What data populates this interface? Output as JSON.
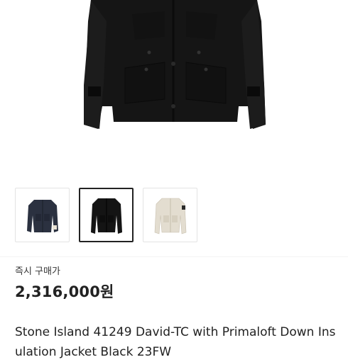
{
  "images": {
    "thumbnails": [
      {
        "icon": "jacket-navy-thumbnail-icon",
        "color": "#2b3140"
      },
      {
        "icon": "jacket-black-thumbnail-icon",
        "color": "#141414"
      },
      {
        "icon": "jacket-beige-thumbnail-icon",
        "color": "#e3ddd0"
      }
    ],
    "selected_index": 1
  },
  "listing": {
    "purchase_label": "즉시 구매가",
    "price": "2,316,000원",
    "title": "Stone Island 41249 David-TC with Primaloft Down Insulation Jacket Black 23FW"
  }
}
